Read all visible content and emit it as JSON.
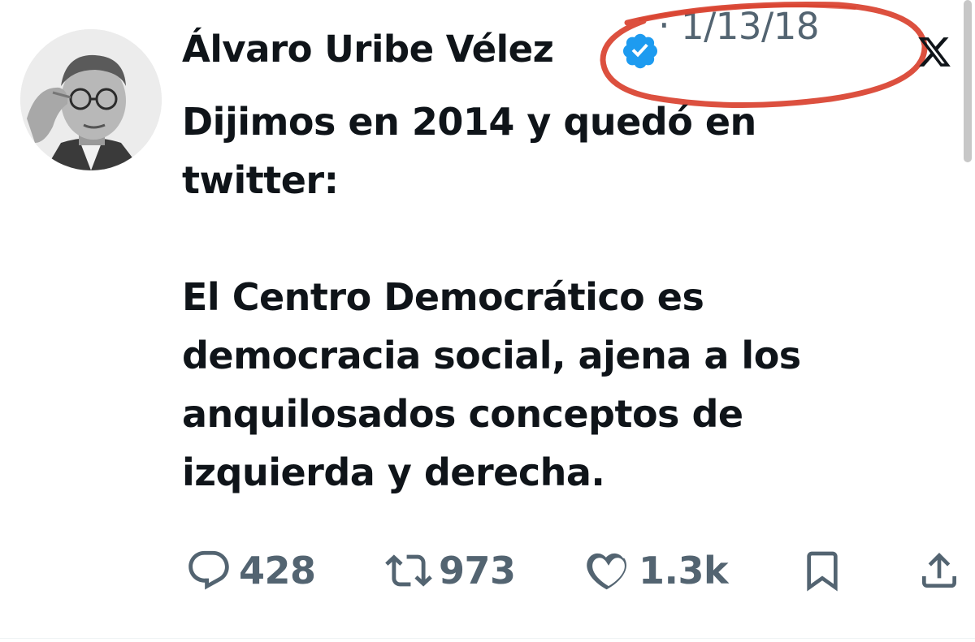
{
  "tweet": {
    "author": {
      "display_name": "Álvaro Uribe Vélez",
      "verified_icon": "verified-badge-icon",
      "avatar_icon": "profile-photo"
    },
    "separator": "·",
    "date": "1/13/18",
    "platform_icon": "x-logo-icon",
    "text": "Dijimos en 2014 y quedó en\ntwitter:\n\nEl Centro Democrático es\ndemocracia social, ajena a los\nanquilosados conceptos de\nizquierda y derecha.",
    "metrics": {
      "replies": "428",
      "retweets": "973",
      "likes": "1.3k"
    },
    "action_icons": [
      "reply-icon",
      "retweet-icon",
      "like-icon",
      "bookmark-icon",
      "share-icon"
    ]
  },
  "annotation": {
    "type": "red-hand-drawn-ellipse",
    "color": "#d9412f"
  },
  "colors": {
    "text_primary": "#0f1419",
    "text_secondary": "#536471",
    "verified_blue": "#1d9bf0"
  }
}
